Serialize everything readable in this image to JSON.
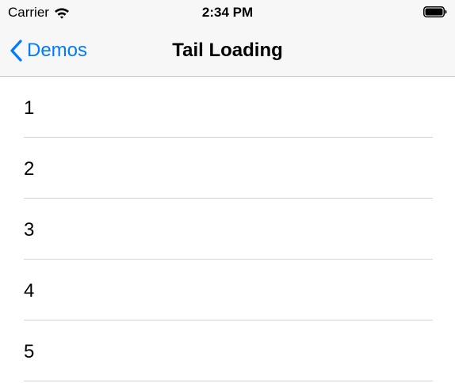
{
  "status_bar": {
    "carrier": "Carrier",
    "time": "2:34 PM",
    "wifi_icon": "wifi-icon",
    "battery_icon": "battery-full-icon"
  },
  "nav_bar": {
    "back_label": "Demos",
    "back_icon": "chevron-left-icon",
    "title": "Tail Loading"
  },
  "list": {
    "items": [
      {
        "label": "1"
      },
      {
        "label": "2"
      },
      {
        "label": "3"
      },
      {
        "label": "4"
      },
      {
        "label": "5"
      }
    ]
  },
  "colors": {
    "accent": "#007aff",
    "bar_background": "#f7f7f7",
    "separator": "#d3d3d6"
  }
}
